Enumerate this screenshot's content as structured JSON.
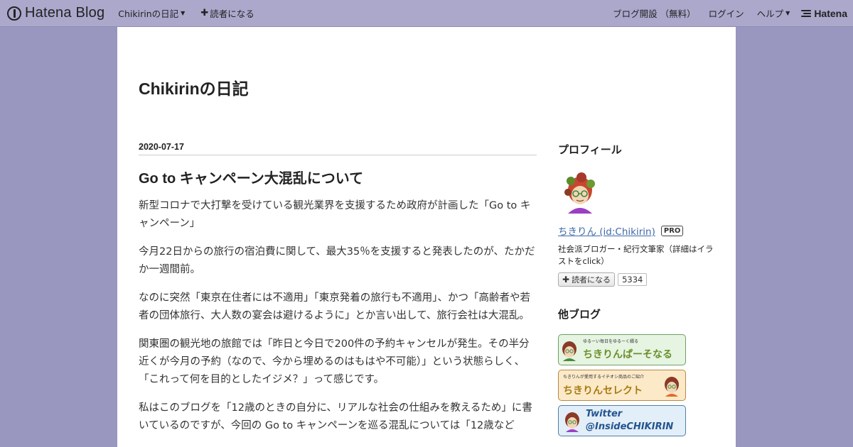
{
  "topbar": {
    "logo_text": "Hatena Blog",
    "blog_menu": "Chikirinの日記",
    "subscribe": "読者になる",
    "open_blog": "ブログ開設 （無料）",
    "login": "ログイン",
    "help": "ヘルプ",
    "hatena_brand": "Hatena"
  },
  "blog": {
    "title": "Chikirinの日記"
  },
  "entry": {
    "date": "2020-07-17",
    "title": "Go to キャンペーン大混乱について",
    "paragraphs": [
      "新型コロナで大打撃を受けている観光業界を支援するため政府が計画した「Go to キャンペーン」",
      "今月22日からの旅行の宿泊費に関して、最大35％を支援すると発表したのが、たかだか一週間前。",
      "なのに突然「東京在住者には不適用」「東京発着の旅行も不適用」、かつ「高齢者や若者の団体旅行、大人数の宴会は避けるように」とか言い出して、旅行会社は大混乱。",
      "関東圏の観光地の旅館では「昨日と今日で200件の予約キャンセルが発生。その半分近くが今月の予約（なので、今から埋めるのはもはや不可能）」という状態らしく、「これって何を目的としたイジメ？」って感じです。",
      "私はこのブログを「12歳のときの自分に、リアルな社会の仕組みを教えるため」に書いているのですが、今回の Go to キャンペーンを巡る混乱については「12歳など"
    ]
  },
  "sidebar": {
    "profile_heading": "プロフィール",
    "profile_name": "ちきりん (id:Chikirin)",
    "pro_badge": "PRO",
    "profile_desc": "社会派ブロガー・紀行文筆家（詳細はイラストをclick）",
    "subscribe_label": "読者になる",
    "subscriber_count": "5334",
    "other_blogs_heading": "他ブログ",
    "banners": [
      {
        "sub": "ゆるーい毎日をゆるーく綴る",
        "text": "ちきりんぱーそなる"
      },
      {
        "sub": "ちきりんが愛用するイチオシ商品のご紹介",
        "text": "ちきりんセレクト"
      },
      {
        "line1": "Twitter",
        "line2": "@InsideCHIKIRIN"
      }
    ]
  },
  "colors": {
    "page_bg": "#9996c0",
    "topbar_bg": "#aba8cc",
    "link": "#3f6aa8"
  }
}
